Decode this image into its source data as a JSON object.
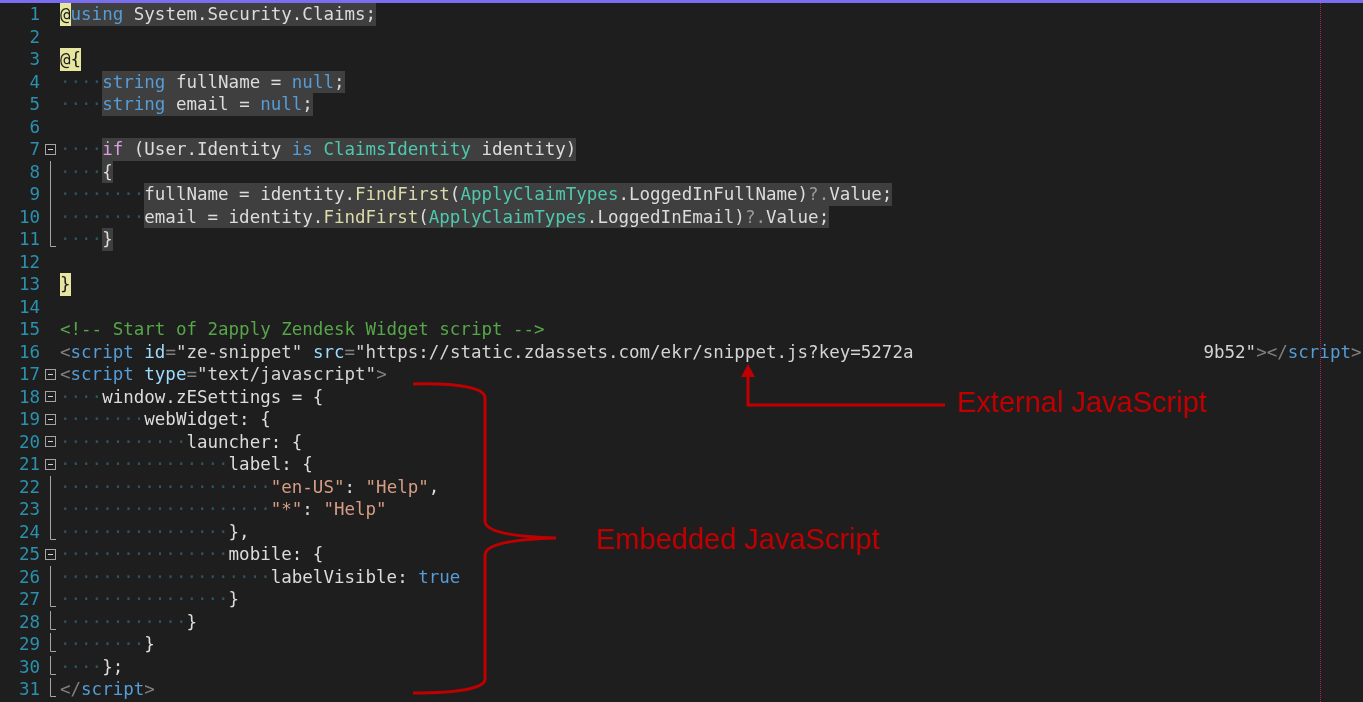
{
  "lines": [
    {
      "number": "1",
      "kind": "plain",
      "highlighted": true,
      "tokens": [
        {
          "text": "@",
          "kind": "razor"
        },
        {
          "text": "using",
          "kind": "keyword"
        },
        {
          "text": " System.Security.Claims;",
          "kind": "plain"
        }
      ]
    },
    {
      "number": "2",
      "kind": "plain"
    },
    {
      "number": "3",
      "kind": "plain",
      "tokens": [
        {
          "text": "@{",
          "kind": "razor"
        }
      ]
    },
    {
      "number": "4",
      "kind": "plain",
      "highlighted": true,
      "tokens": [
        {
          "text": "····",
          "kind": "whitespace"
        },
        {
          "text": "string",
          "kind": "keyword"
        },
        {
          "text": " fullName = ",
          "kind": "plain"
        },
        {
          "text": "null",
          "kind": "keyword"
        },
        {
          "text": ";",
          "kind": "plain"
        }
      ]
    },
    {
      "number": "5",
      "kind": "plain",
      "highlighted": true,
      "tokens": [
        {
          "text": "····",
          "kind": "whitespace"
        },
        {
          "text": "string",
          "kind": "keyword"
        },
        {
          "text": " email = ",
          "kind": "plain"
        },
        {
          "text": "null",
          "kind": "keyword"
        },
        {
          "text": ";",
          "kind": "plain"
        }
      ]
    },
    {
      "number": "6",
      "kind": "plain"
    },
    {
      "number": "7",
      "kind": "fold-start",
      "highlighted": true,
      "tokens": [
        {
          "text": "····",
          "kind": "whitespace"
        },
        {
          "text": "if",
          "kind": "control"
        },
        {
          "text": " (User.Identity ",
          "kind": "plain"
        },
        {
          "text": "is",
          "kind": "keyword"
        },
        {
          "text": " ClaimsIdentity",
          "kind": "type"
        },
        {
          "text": " identity)",
          "kind": "plain"
        }
      ]
    },
    {
      "number": "8",
      "kind": "fold-inside",
      "highlighted": true,
      "tokens": [
        {
          "text": "····",
          "kind": "whitespace"
        },
        {
          "text": "{",
          "kind": "plain"
        }
      ]
    },
    {
      "number": "9",
      "kind": "fold-inside",
      "highlighted": true,
      "tokens": [
        {
          "text": "········",
          "kind": "whitespace"
        },
        {
          "text": "fullName = identity.",
          "kind": "plain"
        },
        {
          "text": "FindFirst",
          "kind": "method"
        },
        {
          "text": "(",
          "kind": "plain"
        },
        {
          "text": "ApplyClaimTypes",
          "kind": "type"
        },
        {
          "text": ".LoggedInFullName)",
          "kind": "plain"
        },
        {
          "text": "?.",
          "kind": "operator"
        },
        {
          "text": "Value;",
          "kind": "plain"
        }
      ]
    },
    {
      "number": "10",
      "kind": "fold-inside",
      "highlighted": true,
      "tokens": [
        {
          "text": "········",
          "kind": "whitespace"
        },
        {
          "text": "email = identity.",
          "kind": "plain"
        },
        {
          "text": "FindFirst",
          "kind": "method"
        },
        {
          "text": "(",
          "kind": "plain"
        },
        {
          "text": "ApplyClaimTypes",
          "kind": "type"
        },
        {
          "text": ".LoggedInEmail)",
          "kind": "plain"
        },
        {
          "text": "?.",
          "kind": "operator"
        },
        {
          "text": "Value;",
          "kind": "plain"
        }
      ]
    },
    {
      "number": "11",
      "kind": "fold-end",
      "highlighted": true,
      "tokens": [
        {
          "text": "····",
          "kind": "whitespace"
        },
        {
          "text": "}",
          "kind": "plain"
        }
      ]
    },
    {
      "number": "12",
      "kind": "plain"
    },
    {
      "number": "13",
      "kind": "plain",
      "tokens": [
        {
          "text": "}",
          "kind": "razor"
        }
      ]
    },
    {
      "number": "14",
      "kind": "plain"
    },
    {
      "number": "15",
      "kind": "plain",
      "highlighted": false,
      "tokens": [
        {
          "text": "<!-- Start of 2apply Zendesk Widget script -->",
          "kind": "comment"
        }
      ]
    },
    {
      "number": "16",
      "kind": "plain",
      "highlighted": false,
      "tokens": [
        {
          "text": "<",
          "kind": "delimiter"
        },
        {
          "text": "script",
          "kind": "tag"
        },
        {
          "text": " id",
          "kind": "attribute"
        },
        {
          "text": "=",
          "kind": "delimiter"
        },
        {
          "text": "\"ze-snippet\"",
          "kind": "value"
        },
        {
          "text": " src",
          "kind": "attribute"
        },
        {
          "text": "=",
          "kind": "delimiter"
        },
        {
          "text": "\"https://static.zdassets.com/ekr/snippet.js?key=5272a",
          "kind": "value"
        },
        {
          "kind": "gap"
        },
        {
          "text": "9b52\"",
          "kind": "value"
        },
        {
          "text": "></",
          "kind": "delimiter"
        },
        {
          "text": "script",
          "kind": "tag"
        },
        {
          "text": ">",
          "kind": "delimiter"
        }
      ]
    },
    {
      "number": "17",
      "kind": "fold-start",
      "highlighted": false,
      "tokens": [
        {
          "text": "<",
          "kind": "delimiter"
        },
        {
          "text": "script",
          "kind": "tag"
        },
        {
          "text": " type",
          "kind": "attribute"
        },
        {
          "text": "=",
          "kind": "delimiter"
        },
        {
          "text": "\"text/javascript\"",
          "kind": "value"
        },
        {
          "text": ">",
          "kind": "delimiter"
        }
      ]
    },
    {
      "number": "18",
      "kind": "fold-start",
      "highlighted": false,
      "tokens": [
        {
          "text": "····",
          "kind": "whitespace"
        },
        {
          "text": "window.zESettings = {",
          "kind": "plain"
        }
      ]
    },
    {
      "number": "19",
      "kind": "fold-start",
      "highlighted": false,
      "tokens": [
        {
          "text": "········",
          "kind": "whitespace"
        },
        {
          "text": "webWidget: {",
          "kind": "plain"
        }
      ]
    },
    {
      "number": "20",
      "kind": "fold-start",
      "highlighted": false,
      "tokens": [
        {
          "text": "············",
          "kind": "whitespace"
        },
        {
          "text": "launcher: {",
          "kind": "plain"
        }
      ]
    },
    {
      "number": "21",
      "kind": "fold-start",
      "highlighted": false,
      "tokens": [
        {
          "text": "················",
          "kind": "whitespace"
        },
        {
          "text": "label: {",
          "kind": "plain"
        }
      ]
    },
    {
      "number": "22",
      "kind": "fold-inside",
      "highlighted": false,
      "tokens": [
        {
          "text": "····················",
          "kind": "whitespace"
        },
        {
          "text": "\"en-US\"",
          "kind": "string"
        },
        {
          "text": ": ",
          "kind": "plain"
        },
        {
          "text": "\"Help\"",
          "kind": "string"
        },
        {
          "text": ",",
          "kind": "plain"
        }
      ]
    },
    {
      "number": "23",
      "kind": "fold-inside",
      "highlighted": false,
      "tokens": [
        {
          "text": "····················",
          "kind": "whitespace"
        },
        {
          "text": "\"*\"",
          "kind": "string"
        },
        {
          "text": ": ",
          "kind": "plain"
        },
        {
          "text": "\"Help\"",
          "kind": "string"
        }
      ]
    },
    {
      "number": "24",
      "kind": "fold-end",
      "highlighted": false,
      "tokens": [
        {
          "text": "················",
          "kind": "whitespace"
        },
        {
          "text": "},",
          "kind": "plain"
        }
      ]
    },
    {
      "number": "25",
      "kind": "fold-start",
      "highlighted": false,
      "tokens": [
        {
          "text": "················",
          "kind": "whitespace"
        },
        {
          "text": "mobile: {",
          "kind": "plain"
        }
      ]
    },
    {
      "number": "26",
      "kind": "fold-inside",
      "highlighted": false,
      "tokens": [
        {
          "text": "····················",
          "kind": "whitespace"
        },
        {
          "text": "labelVisible: ",
          "kind": "plain"
        },
        {
          "text": "true",
          "kind": "keyword"
        }
      ]
    },
    {
      "number": "27",
      "kind": "fold-end",
      "highlighted": false,
      "tokens": [
        {
          "text": "················",
          "kind": "whitespace"
        },
        {
          "text": "}",
          "kind": "plain"
        }
      ]
    },
    {
      "number": "28",
      "kind": "fold-end",
      "highlighted": false,
      "tokens": [
        {
          "text": "············",
          "kind": "whitespace"
        },
        {
          "text": "}",
          "kind": "plain"
        }
      ]
    },
    {
      "number": "29",
      "kind": "fold-end",
      "highlighted": false,
      "tokens": [
        {
          "text": "········",
          "kind": "whitespace"
        },
        {
          "text": "}",
          "kind": "plain"
        }
      ]
    },
    {
      "number": "30",
      "kind": "fold-end",
      "highlighted": false,
      "tokens": [
        {
          "text": "····",
          "kind": "whitespace"
        },
        {
          "text": "};",
          "kind": "plain"
        }
      ]
    },
    {
      "number": "31",
      "kind": "fold-end",
      "highlighted": false,
      "tokens": [
        {
          "text": "</",
          "kind": "delimiter"
        },
        {
          "text": "script",
          "kind": "tag"
        },
        {
          "text": ">",
          "kind": "delimiter"
        }
      ]
    }
  ],
  "annotations": [
    {
      "kind": "arrow",
      "text": "External JavaScript"
    },
    {
      "kind": "brace",
      "text": "Embedded JavaScript"
    }
  ]
}
